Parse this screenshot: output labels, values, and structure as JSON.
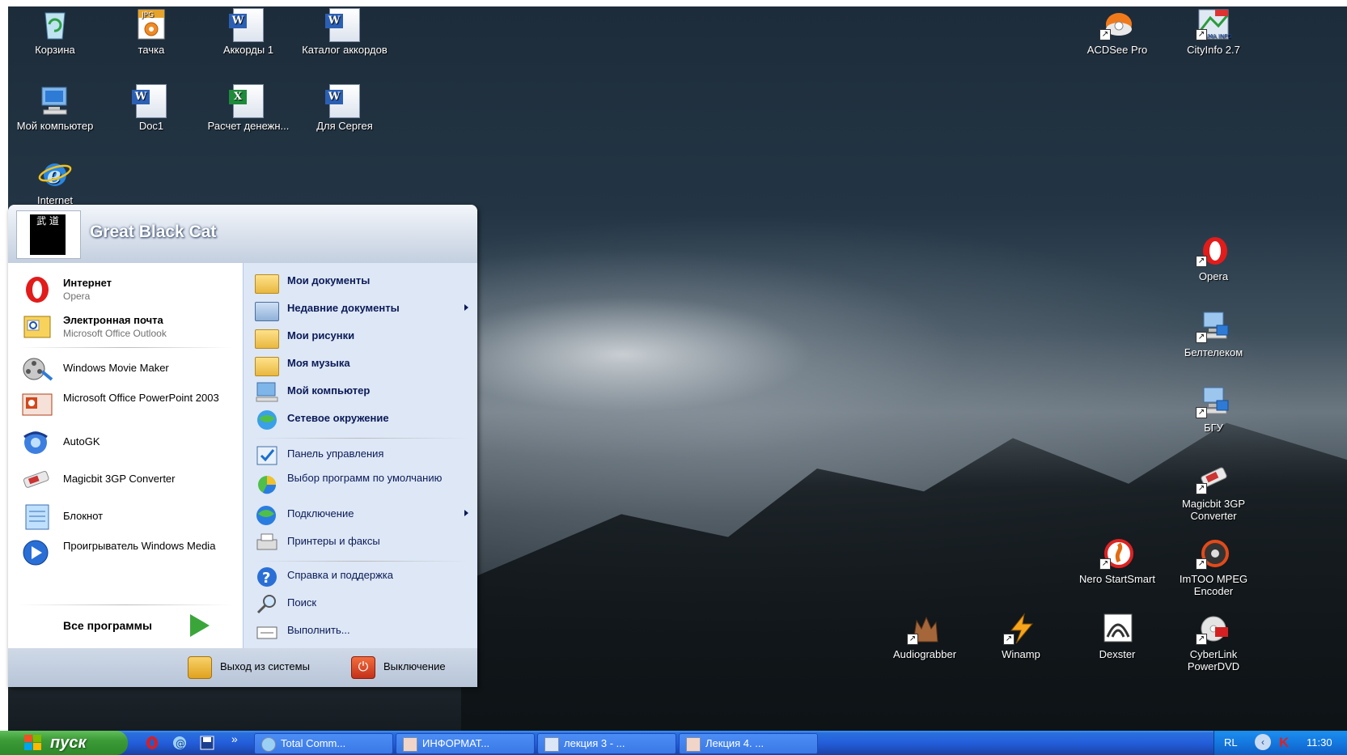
{
  "desktop_icons_left": [
    {
      "label": "Корзина",
      "icon": "recycle-bin-icon"
    },
    {
      "label": "тачка",
      "icon": "jpg-file-icon",
      "badge": "JPG"
    },
    {
      "label": "Аккорды 1",
      "icon": "word-document-icon"
    },
    {
      "label": "Каталог аккордов",
      "icon": "word-document-icon"
    },
    {
      "label": "Мой компьютер",
      "icon": "my-computer-icon"
    },
    {
      "label": "Doc1",
      "icon": "word-document-icon"
    },
    {
      "label": "Расчет денежн...",
      "icon": "excel-document-icon"
    },
    {
      "label": "Для Сергея",
      "icon": "word-document-icon"
    },
    {
      "label": "Internet",
      "icon": "internet-explorer-icon"
    }
  ],
  "desktop_icons_right": [
    {
      "label": "ACDSee Pro",
      "icon": "acdsee-icon"
    },
    {
      "label": "CityInfo 2.7",
      "icon": "cityinfo-icon",
      "badge": "ESMA INFO"
    },
    {
      "label": "Opera",
      "icon": "opera-icon"
    },
    {
      "label": "Белтелеком",
      "icon": "network-computer-icon"
    },
    {
      "label": "БГУ",
      "icon": "network-computer-icon"
    },
    {
      "label": "Magicbit 3GP Converter",
      "icon": "magicbit-icon"
    },
    {
      "label": "Nero StartSmart",
      "icon": "nero-icon"
    },
    {
      "label": "ImTOO MPEG Encoder",
      "icon": "imtoo-icon"
    },
    {
      "label": "Audiograbber",
      "icon": "audiograbber-icon"
    },
    {
      "label": "Winamp",
      "icon": "winamp-icon"
    },
    {
      "label": "Dexster",
      "icon": "dexster-icon"
    },
    {
      "label": "CyberLink PowerDVD",
      "icon": "powerdvd-icon"
    }
  ],
  "start_menu": {
    "user": "Great Black Cat",
    "avatar_text": "武 道",
    "pinned": [
      {
        "title": "Интернет",
        "subtitle": "Opera",
        "icon": "opera-icon"
      },
      {
        "title": "Электронная почта",
        "subtitle": "Microsoft Office Outlook",
        "icon": "outlook-icon"
      }
    ],
    "recent": [
      {
        "title": "Windows Movie Maker",
        "icon": "movie-maker-icon"
      },
      {
        "title": "Microsoft Office PowerPoint 2003",
        "icon": "powerpoint-icon"
      },
      {
        "title": "AutoGK",
        "icon": "autogk-icon"
      },
      {
        "title": "Magicbit 3GP Converter",
        "icon": "magicbit-icon"
      },
      {
        "title": "Блокнот",
        "icon": "notepad-icon"
      },
      {
        "title": "Проигрыватель Windows Media",
        "icon": "media-player-icon"
      }
    ],
    "all_programs": "Все программы",
    "places": [
      {
        "title": "Мои документы",
        "icon": "my-documents-icon"
      },
      {
        "title": "Недавние документы",
        "icon": "recent-documents-icon"
      },
      {
        "title": "Мои рисунки",
        "icon": "my-pictures-icon"
      },
      {
        "title": "Моя музыка",
        "icon": "my-music-icon"
      },
      {
        "title": "Мой компьютер",
        "icon": "my-computer-icon"
      },
      {
        "title": "Сетевое окружение",
        "icon": "network-places-icon"
      }
    ],
    "system": [
      {
        "title": "Панель управления",
        "icon": "control-panel-icon"
      },
      {
        "title": "Выбор программ по умолчанию",
        "icon": "default-programs-icon"
      },
      {
        "title": "Подключение",
        "icon": "connect-icon"
      },
      {
        "title": "Принтеры и факсы",
        "icon": "printers-icon"
      }
    ],
    "help": [
      {
        "title": "Справка и поддержка",
        "icon": "help-icon"
      },
      {
        "title": "Поиск",
        "icon": "search-icon"
      },
      {
        "title": "Выполнить...",
        "icon": "run-icon"
      }
    ],
    "logoff": "Выход из системы",
    "shutdown": "Выключение"
  },
  "taskbar": {
    "start_label": "пуск",
    "quick_launch_more": "»",
    "tasks": [
      {
        "label": "Total Comm...",
        "icon": "total-commander-icon"
      },
      {
        "label": "ИНФОРМАТ...",
        "icon": "powerpoint-icon"
      },
      {
        "label": "лекция 3 - ...",
        "icon": "word-document-icon"
      },
      {
        "label": "Лекция 4. ...",
        "icon": "powerpoint-icon"
      }
    ],
    "language": "RL",
    "clock": "11:30"
  },
  "colors": {
    "taskbar_blue": "#245edb",
    "start_green": "#3c9a37",
    "menu_right_panel": "#dde7f6",
    "link_text": "#0b1a57"
  }
}
